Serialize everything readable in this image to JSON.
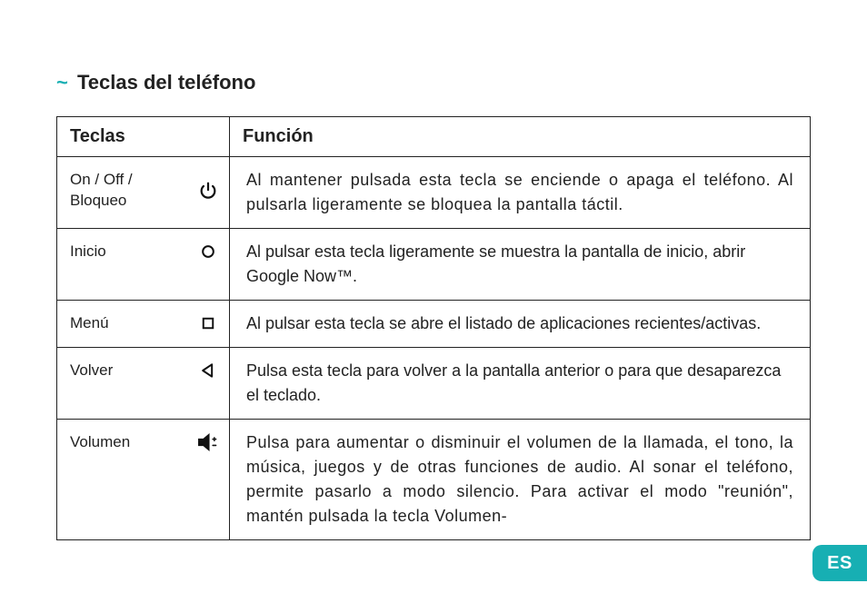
{
  "heading": {
    "tilde": "~",
    "text": "Teclas del teléfono"
  },
  "table": {
    "headers": {
      "keys": "Teclas",
      "func": "Función"
    },
    "rows": [
      {
        "key": "On / Off / Bloqueo",
        "icon": "power-icon",
        "func": "Al mantener pulsada esta tecla se enciende o apaga el teléfono. Al pulsarla ligeramente se bloquea la pantalla táctil."
      },
      {
        "key": "Inicio",
        "icon": "home-circle-icon",
        "func": "Al pulsar esta tecla ligeramente se muestra la pantalla de inicio, abrir Google Now™."
      },
      {
        "key": "Menú",
        "icon": "menu-square-icon",
        "func": "Al pulsar esta tecla se abre el listado de aplicaciones recientes/activas."
      },
      {
        "key": "Volver",
        "icon": "back-triangle-icon",
        "func": "Pulsa esta tecla para volver a la pantalla anterior o para que desaparezca el teclado."
      },
      {
        "key": "Volumen",
        "icon": "volume-icon",
        "func": "Pulsa para aumentar o disminuir el volumen de la llamada, el tono, la música, juegos y de otras funciones de audio. Al sonar el teléfono, permite pasarlo a modo silencio. Para activar el modo \"reunión\", mantén pulsada la tecla Volumen-"
      }
    ]
  },
  "langBadge": "ES"
}
